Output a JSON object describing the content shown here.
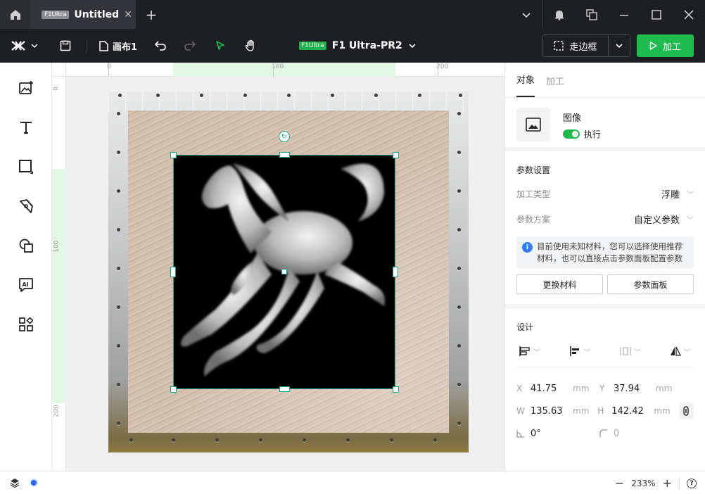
{
  "titlebar": {
    "tab_badge": "F1Ultra",
    "tab_title": "Untitled"
  },
  "toolbar": {
    "canvas_name": "画布1",
    "device_badge": "F1Ultra",
    "device_name": "F1 Ultra-PR2",
    "frame_label": "走边框",
    "process_label": "加工"
  },
  "rulers": {
    "top": [
      "0",
      "100",
      "200"
    ],
    "left": [
      "0",
      "100",
      "200"
    ]
  },
  "panel": {
    "tabs": [
      "对象",
      "加工"
    ],
    "object_name": "图像",
    "execute_label": "执行",
    "params_title": "参数设置",
    "process_type_label": "加工类型",
    "process_type_value": "浮雕",
    "param_scheme_label": "参数方案",
    "param_scheme_value": "自定义参数",
    "info_text": "目前使用未知材料，您可以选择使用推荐材料，也可以直接点击参数面板配置参数",
    "change_material": "更换材料",
    "param_panel": "参数面板",
    "design_title": "设计",
    "x_label": "X",
    "x_value": "41.75",
    "y_label": "Y",
    "y_value": "37.94",
    "w_label": "W",
    "w_value": "135.63",
    "h_label": "H",
    "h_value": "142.42",
    "unit": "mm",
    "angle_value": "0°",
    "radius_value": "0"
  },
  "status": {
    "zoom": "233%"
  },
  "colors": {
    "accent_green": "#1fbb4f",
    "selection": "#19a58a",
    "dark_bg": "#1e1f22"
  }
}
